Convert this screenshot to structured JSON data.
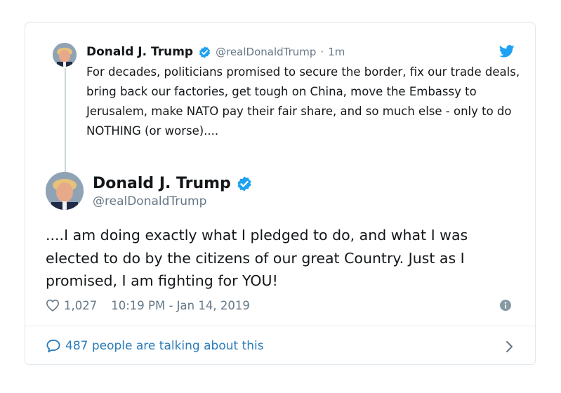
{
  "colors": {
    "verified_blue": "#1da1f2",
    "link_blue": "#2b7bb9",
    "muted_gray": "#657786",
    "border": "#e1e8ed"
  },
  "parent_tweet": {
    "author_name": "Donald J. Trump",
    "handle": "@realDonaldTrump",
    "separator": "·",
    "time": "1m",
    "avatar_icon": "profile-photo",
    "verified_icon": "verified-badge-icon",
    "platform_icon": "twitter-bird-icon",
    "text": "For decades, politicians promised to secure the border, fix our trade deals, bring back our factories, get tough on China, move the Embassy to Jerusalem, make NATO pay their fair share, and so much else - only to do NOTHING (or worse)...."
  },
  "main_tweet": {
    "author_name": "Donald J. Trump",
    "handle": "@realDonaldTrump",
    "avatar_icon": "profile-photo",
    "verified_icon": "verified-badge-icon",
    "text": "....I am doing exactly what I pledged to do, and what I was elected to do by the citizens of our great Country. Just as I promised, I am fighting for YOU!",
    "like_icon": "heart-icon",
    "like_count": "1,027",
    "timestamp": "10:19 PM - Jan 14, 2019",
    "info_icon": "info-icon"
  },
  "footer": {
    "talking_icon": "speech-bubble-icon",
    "talking_label": "487 people are talking about this",
    "chevron_icon": "chevron-right-icon"
  }
}
